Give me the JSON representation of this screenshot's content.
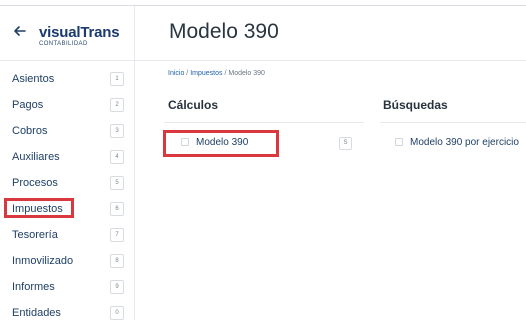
{
  "brand": {
    "name": "visualTrans",
    "subtitle": "CONTABILIDAD"
  },
  "sidebar": {
    "items": [
      {
        "label": "Asientos",
        "key": "1"
      },
      {
        "label": "Pagos",
        "key": "2"
      },
      {
        "label": "Cobros",
        "key": "3"
      },
      {
        "label": "Auxiliares",
        "key": "4"
      },
      {
        "label": "Procesos",
        "key": "5"
      },
      {
        "label": "Impuestos",
        "key": "6"
      },
      {
        "label": "Tesorería",
        "key": "7"
      },
      {
        "label": "Inmovilizado",
        "key": "8"
      },
      {
        "label": "Informes",
        "key": "9"
      },
      {
        "label": "Entidades",
        "key": "0"
      }
    ]
  },
  "page": {
    "title": "Modelo 390"
  },
  "breadcrumb": {
    "home": "Inicio",
    "section": "Impuestos",
    "current": "Modelo 390",
    "separator": "/"
  },
  "sections": {
    "calculos": {
      "title": "Cálculos",
      "items": [
        {
          "label": "Modelo 390",
          "key": "S"
        }
      ]
    },
    "busquedas": {
      "title": "Búsquedas",
      "items": [
        {
          "label": "Modelo 390 por ejercicio"
        }
      ]
    }
  },
  "colors": {
    "highlight": "#d9383f",
    "brand": "#1b3a6e",
    "link": "#1f5fa8"
  },
  "icons": {
    "back": "arrow-left-icon",
    "row": "checkbox-icon"
  }
}
